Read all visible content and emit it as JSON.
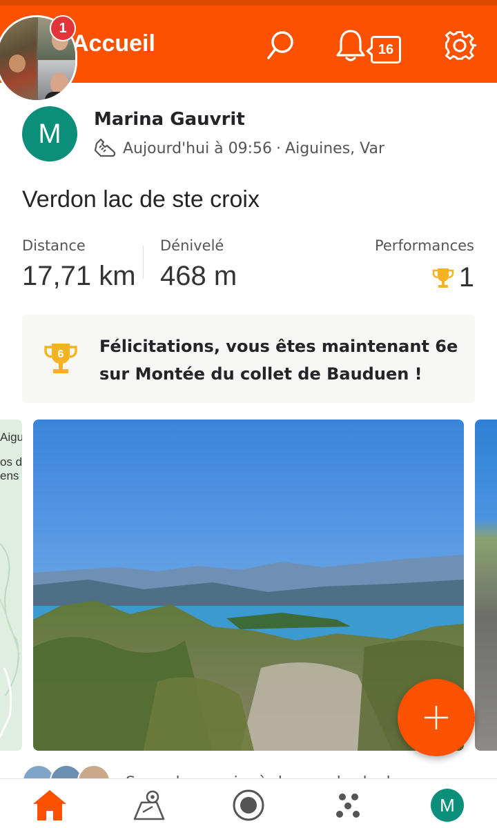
{
  "header": {
    "title": "Accueil",
    "notification_count": "16",
    "stories_badge": "1"
  },
  "activity": {
    "avatar_initial": "M",
    "athlete_name": "Marina Gauvrit",
    "timestamp": "Aujourd'hui à 09:56",
    "separator": "·",
    "location": "Aiguines, Var",
    "title": "Verdon lac de ste croix",
    "stats": {
      "distance_label": "Distance",
      "distance_value": "17,71 km",
      "elevation_label": "Dénivelé",
      "elevation_value": "468 m",
      "performances_label": "Performances",
      "performances_value": "1"
    },
    "achievement": {
      "rank": "6",
      "text": "Félicitations, vous êtes maintenant 6e sur Montée du collet de Bauduen !"
    },
    "map_labels": [
      "Aigu",
      "os du",
      "ens"
    ],
    "kudos_text": "Soyez le premier à donner des kudos"
  },
  "bottom_nav": {
    "profile_initial": "M"
  },
  "colors": {
    "brand_orange": "#fc5200",
    "avatar_teal": "#0c8f7a",
    "trophy_gold": "#f5b324",
    "badge_red": "#e0353a"
  },
  "icons": {
    "search": "search-icon",
    "bell": "bell-icon",
    "settings": "gear-icon",
    "sport": "shoe-icon",
    "trophy": "trophy-icon",
    "fab": "plus-icon",
    "nav": [
      "home-icon",
      "maps-icon",
      "record-icon",
      "groups-icon",
      "profile-avatar"
    ]
  }
}
